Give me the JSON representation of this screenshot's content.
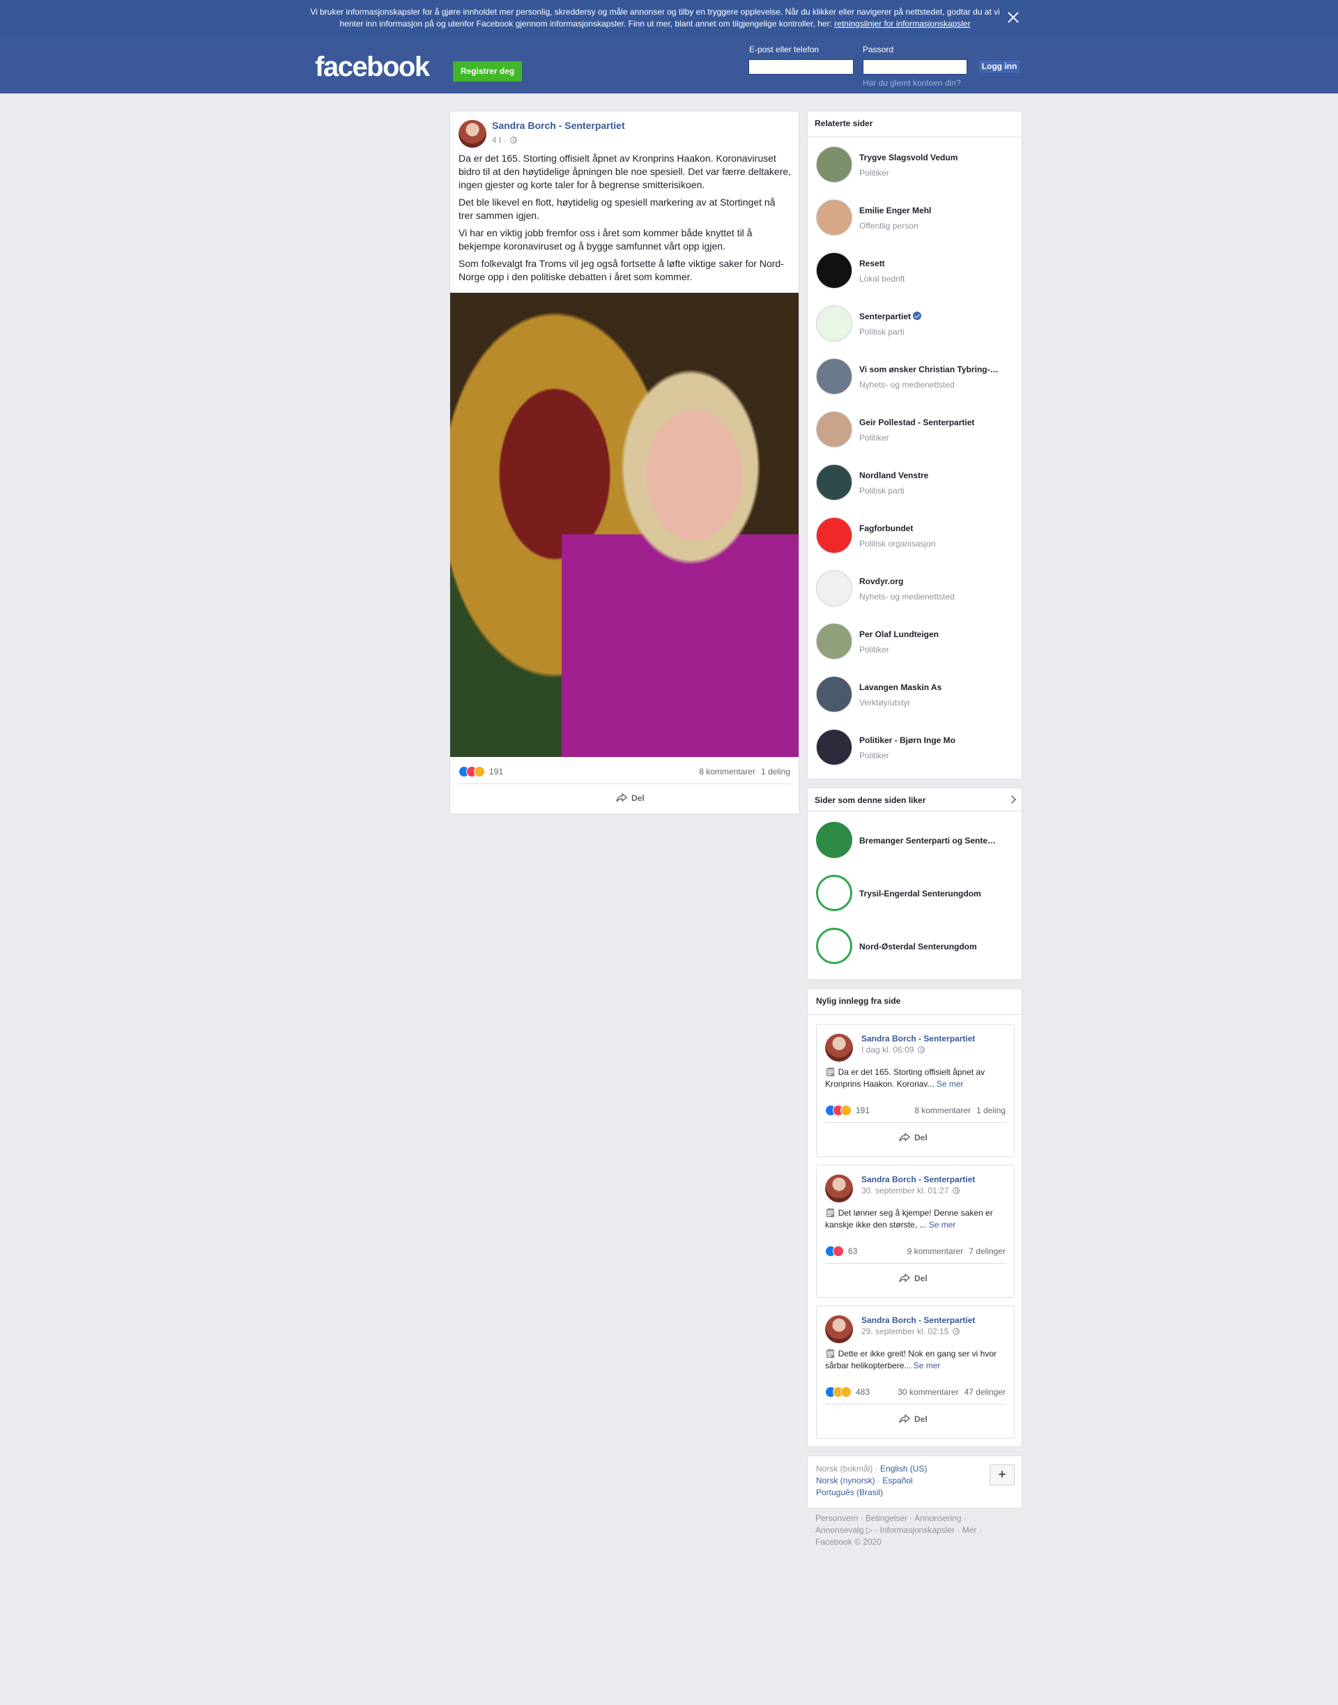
{
  "cookie_banner": {
    "text": "Vi bruker informasjonskapsler for å gjøre innholdet mer personlig, skreddersy og måle annonser og tilby en tryggere opplevelse. Når du klikker eller navigerer på nettstedet, godtar du at vi henter inn informasjon på og utenfor Facebook gjennom informasjonskapsler. Finn ut mer, blant annet om tilgjengelige kontroller, her: ",
    "link": "retningslinjer for informasjonskapsler",
    "close_icon": "close-icon"
  },
  "header": {
    "logo": "facebook",
    "register_label": "Registrer deg",
    "email_label": "E-post eller telefon",
    "password_label": "Passord",
    "login_label": "Logg inn",
    "forgot_label": "Har du glemt kontoen din?"
  },
  "post": {
    "author": "Sandra Borch - Senterpartiet",
    "time": "4 t ·",
    "paragraphs": [
      "Da er det 165. Storting offisielt åpnet av Kronprins Haakon. Koronaviruset bidro til at den høytidelige åpningen ble noe spesiell. Det var færre deltakere, ingen gjester og korte taler for å begrense smitterisikoen.",
      "Det ble likevel en flott, høytidelig og spesiell markering av at Stortinget nå trer sammen igjen.",
      "Vi har en viktig jobb fremfor oss i året som kommer både knyttet til å bekjempe koronaviruset og å bygge samfunnet vårt opp igjen.",
      "Som folkevalgt fra Troms vil jeg også fortsette å løfte viktige saker for Nord-Norge opp i den politiske debatten i året som kommer."
    ],
    "reaction_count": "191",
    "comments": "8 kommentarer",
    "shares": "1 deling",
    "share_label": "Del"
  },
  "related": {
    "title": "Relaterte sider",
    "items": [
      {
        "name": "Trygve Slagsvold Vedum",
        "category": "Politiker"
      },
      {
        "name": "Emilie Enger Mehl",
        "category": "Offentlig person"
      },
      {
        "name": "Resett",
        "category": "Lokal bedrift"
      },
      {
        "name": "Senterpartiet",
        "category": "Politisk parti"
      },
      {
        "name": "Vi som ønsker Christian Tybring-…",
        "category": "Nyhets- og medienettsted"
      },
      {
        "name": "Geir Pollestad - Senterpartiet",
        "category": "Politiker"
      },
      {
        "name": "Nordland Venstre",
        "category": "Politisk parti"
      },
      {
        "name": "Fagforbundet",
        "category": "Politisk organisasjon"
      },
      {
        "name": "Rovdyr.org",
        "category": "Nyhets- og medienettsted"
      },
      {
        "name": "Per Olaf Lundteigen",
        "category": "Politiker"
      },
      {
        "name": "Lavangen Maskin As",
        "category": "Verktøy/utstyr"
      },
      {
        "name": "Politiker - Bjørn Inge Mo",
        "category": "Politiker"
      }
    ]
  },
  "liked": {
    "title": "Sider som denne siden liker",
    "items": [
      {
        "name": "Bremanger Senterparti og Sente…"
      },
      {
        "name": "Trysil-Engerdal Senterungdom"
      },
      {
        "name": "Nord-Østerdal Senterungdom"
      }
    ]
  },
  "recent": {
    "title": "Nylig innlegg fra side",
    "posts": [
      {
        "author": "Sandra Borch - Senterpartiet",
        "date": "I dag kl. 06:09",
        "text": "Da er det 165. Storting offisielt åpnet av Kronprins Haakon. Koronav... ",
        "more": "Se mer",
        "count": "191",
        "comments": "8 kommentarer",
        "shares": "1 deling",
        "share": "Del"
      },
      {
        "author": "Sandra Borch - Senterpartiet",
        "date": "30. september kl. 01:27",
        "text": "Det lønner seg å kjempe! Denne saken er kanskje ikke den største, ... ",
        "more": "Se mer",
        "count": "63",
        "comments": "9 kommentarer",
        "shares": "7 delinger",
        "share": "Del"
      },
      {
        "author": "Sandra Borch - Senterpartiet",
        "date": "29. september kl. 02:15",
        "text": "Dette er ikke greit! Nok en gang ser vi hvor sårbar helikopterbere... ",
        "more": "Se mer",
        "count": "483",
        "comments": "30 kommentarer",
        "shares": "47 delinger",
        "share": "Del"
      }
    ]
  },
  "languages": {
    "current": "Norsk (bokmål) · ",
    "links": [
      "English (US)",
      "Norsk (nynorsk)",
      "Español",
      "Português (Brasil)"
    ],
    "plus": "+"
  },
  "footer": {
    "links": [
      "Personvern",
      "Betingelser",
      "Annonsering",
      "Annonsevalg",
      "Informasjonskapsler",
      "Mer"
    ],
    "copyright": "Facebook © 2020"
  }
}
